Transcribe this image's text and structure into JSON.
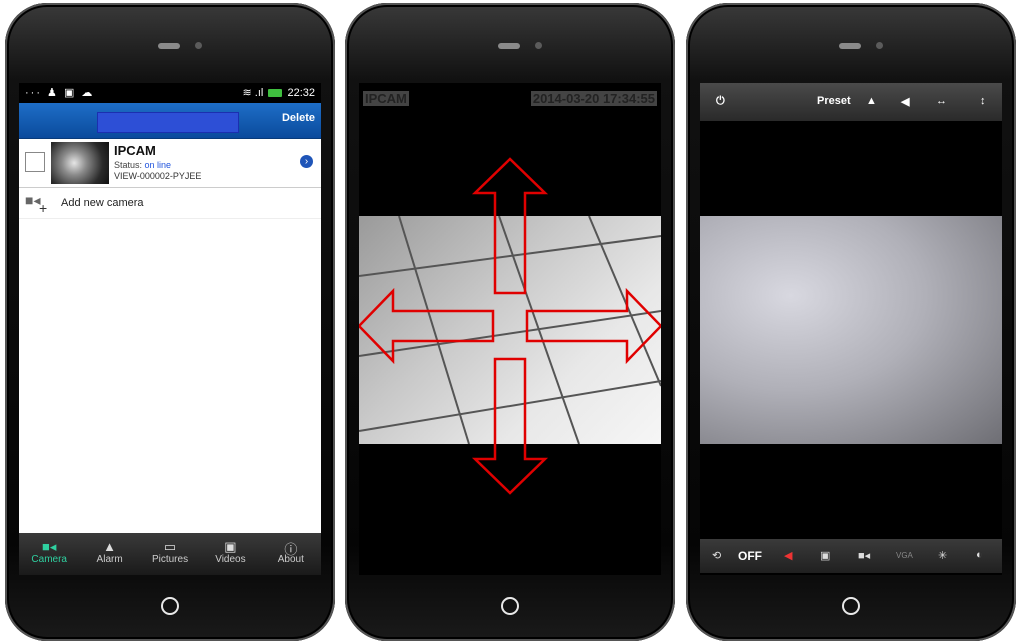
{
  "phone1": {
    "status_bar": {
      "left_icons": "··· ♟ ▣ ☁",
      "time": "22:32"
    },
    "title_bar": {
      "delete_label": "Delete"
    },
    "camera": {
      "name": "IPCAM",
      "status_label": "Status:",
      "status_value": "on line",
      "id": "VIEW-000002-PYJEE"
    },
    "add_camera_label": "Add new camera",
    "tabs": [
      {
        "label": "Camera",
        "icon": "camera-icon",
        "active": true
      },
      {
        "label": "Alarm",
        "icon": "bell-icon",
        "active": false
      },
      {
        "label": "Pictures",
        "icon": "picture-icon",
        "active": false
      },
      {
        "label": "Videos",
        "icon": "video-icon",
        "active": false
      },
      {
        "label": "About",
        "icon": "info-icon",
        "active": false
      }
    ]
  },
  "phone2": {
    "osd_name": "IPCAM",
    "osd_timestamp": "2014-03-20 17:34:55",
    "arrow_color": "#e00000"
  },
  "phone3": {
    "top_bar": {
      "preset_label": "Preset"
    },
    "bottom_bar": {
      "off_label": "OFF",
      "vga_label": "VGA"
    }
  }
}
